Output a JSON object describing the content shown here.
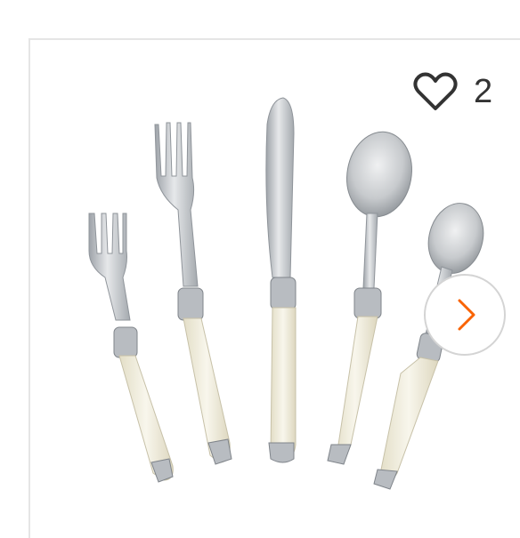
{
  "product": {
    "favorite_count": "2",
    "image_icon": "flatware-set-image"
  },
  "icons": {
    "favorite": "heart-outline-icon",
    "next": "chevron-right-icon"
  },
  "colors": {
    "accent": "#f96302",
    "card_border": "#e5e5e5",
    "handle_ivory": "#f2eedd",
    "steel": "#c9ccd0"
  }
}
